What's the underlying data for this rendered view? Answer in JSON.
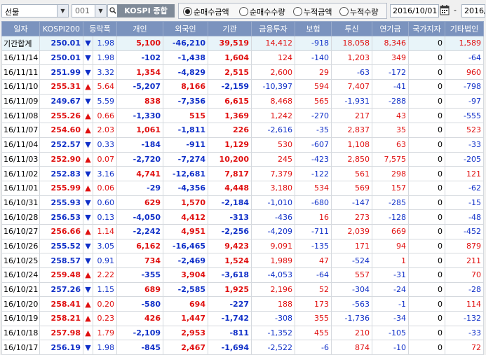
{
  "toolbar": {
    "investor_select": "선물",
    "code_select": "001",
    "search_icon": "search-icon",
    "market_label": "KOSPI 종합",
    "radios": [
      {
        "label": "순매수금액",
        "selected": true
      },
      {
        "label": "순매수수량",
        "selected": false
      },
      {
        "label": "누적금액",
        "selected": false
      },
      {
        "label": "누적수량",
        "selected": false
      }
    ],
    "start_date": "2016/10/01",
    "end_date": "2016/1",
    "tilde": "-"
  },
  "table": {
    "headers": [
      "일자",
      "KOSPI200",
      "등락폭",
      "",
      "개인",
      "외국인",
      "기관",
      "금융투자",
      "보험",
      "투신",
      "연기금",
      "국가지자",
      "기타법인"
    ],
    "rows": [
      {
        "date": "기간합계",
        "kospi": "250.01",
        "dir": "down",
        "chg": "1.98",
        "indiv": "5,100",
        "foreign": "-46,210",
        "inst": "39,519",
        "fin": "14,412",
        "ins": "-918",
        "trust": "18,058",
        "pension": "8,346",
        "gov": "0",
        "corp": "1,589"
      },
      {
        "date": "16/11/14",
        "kospi": "250.01",
        "dir": "down",
        "chg": "1.98",
        "indiv": "-102",
        "foreign": "-1,438",
        "inst": "1,604",
        "fin": "124",
        "ins": "-140",
        "trust": "1,203",
        "pension": "349",
        "gov": "0",
        "corp": "-64"
      },
      {
        "date": "16/11/11",
        "kospi": "251.99",
        "dir": "down",
        "chg": "3.32",
        "indiv": "1,354",
        "foreign": "-4,829",
        "inst": "2,515",
        "fin": "2,600",
        "ins": "29",
        "trust": "-63",
        "pension": "-172",
        "gov": "0",
        "corp": "960"
      },
      {
        "date": "16/11/10",
        "kospi": "255.31",
        "dir": "up",
        "chg": "5.64",
        "indiv": "-5,207",
        "foreign": "8,166",
        "inst": "-2,159",
        "fin": "-10,397",
        "ins": "594",
        "trust": "7,407",
        "pension": "-41",
        "gov": "0",
        "corp": "-798"
      },
      {
        "date": "16/11/09",
        "kospi": "249.67",
        "dir": "down",
        "chg": "5.59",
        "indiv": "838",
        "foreign": "-7,356",
        "inst": "6,615",
        "fin": "8,468",
        "ins": "565",
        "trust": "-1,931",
        "pension": "-288",
        "gov": "0",
        "corp": "-97"
      },
      {
        "date": "16/11/08",
        "kospi": "255.26",
        "dir": "up",
        "chg": "0.66",
        "indiv": "-1,330",
        "foreign": "515",
        "inst": "1,369",
        "fin": "1,242",
        "ins": "-270",
        "trust": "217",
        "pension": "43",
        "gov": "0",
        "corp": "-555"
      },
      {
        "date": "16/11/07",
        "kospi": "254.60",
        "dir": "up",
        "chg": "2.03",
        "indiv": "1,061",
        "foreign": "-1,811",
        "inst": "226",
        "fin": "-2,616",
        "ins": "-35",
        "trust": "2,837",
        "pension": "35",
        "gov": "0",
        "corp": "523"
      },
      {
        "date": "16/11/04",
        "kospi": "252.57",
        "dir": "down",
        "chg": "0.33",
        "indiv": "-184",
        "foreign": "-911",
        "inst": "1,129",
        "fin": "530",
        "ins": "-607",
        "trust": "1,108",
        "pension": "63",
        "gov": "0",
        "corp": "-33"
      },
      {
        "date": "16/11/03",
        "kospi": "252.90",
        "dir": "up",
        "chg": "0.07",
        "indiv": "-2,720",
        "foreign": "-7,274",
        "inst": "10,200",
        "fin": "245",
        "ins": "-423",
        "trust": "2,850",
        "pension": "7,575",
        "gov": "0",
        "corp": "-205"
      },
      {
        "date": "16/11/02",
        "kospi": "252.83",
        "dir": "down",
        "chg": "3.16",
        "indiv": "4,741",
        "foreign": "-12,681",
        "inst": "7,817",
        "fin": "7,379",
        "ins": "-122",
        "trust": "561",
        "pension": "298",
        "gov": "0",
        "corp": "121"
      },
      {
        "date": "16/11/01",
        "kospi": "255.99",
        "dir": "up",
        "chg": "0.06",
        "indiv": "-29",
        "foreign": "-4,356",
        "inst": "4,448",
        "fin": "3,180",
        "ins": "534",
        "trust": "569",
        "pension": "157",
        "gov": "0",
        "corp": "-62"
      },
      {
        "date": "16/10/31",
        "kospi": "255.93",
        "dir": "down",
        "chg": "0.60",
        "indiv": "629",
        "foreign": "1,570",
        "inst": "-2,184",
        "fin": "-1,010",
        "ins": "-680",
        "trust": "-147",
        "pension": "-285",
        "gov": "0",
        "corp": "-15"
      },
      {
        "date": "16/10/28",
        "kospi": "256.53",
        "dir": "down",
        "chg": "0.13",
        "indiv": "-4,050",
        "foreign": "4,412",
        "inst": "-313",
        "fin": "-436",
        "ins": "16",
        "trust": "273",
        "pension": "-128",
        "gov": "0",
        "corp": "-48"
      },
      {
        "date": "16/10/27",
        "kospi": "256.66",
        "dir": "up",
        "chg": "1.14",
        "indiv": "-2,242",
        "foreign": "4,951",
        "inst": "-2,256",
        "fin": "-4,209",
        "ins": "-711",
        "trust": "2,039",
        "pension": "669",
        "gov": "0",
        "corp": "-452"
      },
      {
        "date": "16/10/26",
        "kospi": "255.52",
        "dir": "down",
        "chg": "3.05",
        "indiv": "6,162",
        "foreign": "-16,465",
        "inst": "9,423",
        "fin": "9,091",
        "ins": "-135",
        "trust": "171",
        "pension": "94",
        "gov": "0",
        "corp": "879"
      },
      {
        "date": "16/10/25",
        "kospi": "258.57",
        "dir": "down",
        "chg": "0.91",
        "indiv": "734",
        "foreign": "-2,469",
        "inst": "1,524",
        "fin": "1,989",
        "ins": "47",
        "trust": "-524",
        "pension": "1",
        "gov": "0",
        "corp": "211"
      },
      {
        "date": "16/10/24",
        "kospi": "259.48",
        "dir": "up",
        "chg": "2.22",
        "indiv": "-355",
        "foreign": "3,904",
        "inst": "-3,618",
        "fin": "-4,053",
        "ins": "-64",
        "trust": "557",
        "pension": "-31",
        "gov": "0",
        "corp": "70"
      },
      {
        "date": "16/10/21",
        "kospi": "257.26",
        "dir": "down",
        "chg": "1.15",
        "indiv": "689",
        "foreign": "-2,585",
        "inst": "1,925",
        "fin": "2,196",
        "ins": "52",
        "trust": "-304",
        "pension": "-24",
        "gov": "0",
        "corp": "-28"
      },
      {
        "date": "16/10/20",
        "kospi": "258.41",
        "dir": "up",
        "chg": "0.20",
        "indiv": "-580",
        "foreign": "694",
        "inst": "-227",
        "fin": "188",
        "ins": "173",
        "trust": "-563",
        "pension": "-1",
        "gov": "0",
        "corp": "114"
      },
      {
        "date": "16/10/19",
        "kospi": "258.21",
        "dir": "up",
        "chg": "0.23",
        "indiv": "426",
        "foreign": "1,447",
        "inst": "-1,742",
        "fin": "-308",
        "ins": "355",
        "trust": "-1,736",
        "pension": "-34",
        "gov": "0",
        "corp": "-132"
      },
      {
        "date": "16/10/18",
        "kospi": "257.98",
        "dir": "up",
        "chg": "1.79",
        "indiv": "-2,109",
        "foreign": "2,953",
        "inst": "-811",
        "fin": "-1,352",
        "ins": "455",
        "trust": "210",
        "pension": "-105",
        "gov": "0",
        "corp": "-33"
      },
      {
        "date": "16/10/17",
        "kospi": "256.19",
        "dir": "down",
        "chg": "1.98",
        "indiv": "-845",
        "foreign": "2,467",
        "inst": "-1,694",
        "fin": "-2,522",
        "ins": "-6",
        "trust": "874",
        "pension": "-10",
        "gov": "0",
        "corp": "72"
      }
    ]
  },
  "colors": {
    "header_bg": "#7b93be",
    "up": "#e01010",
    "down": "#1030c8",
    "total_row_bg": "#e8f4f9"
  }
}
